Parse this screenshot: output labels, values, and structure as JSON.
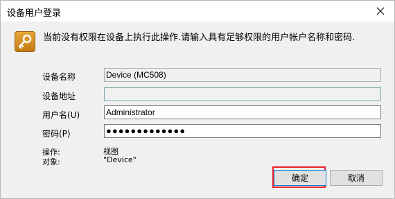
{
  "window": {
    "title": "设备用户登录"
  },
  "message": "当前没有权限在设备上执行此操作.请输入具有足够权限的用户帐户名称和密码.",
  "fields": {
    "device_name": {
      "label": "设备名称",
      "value": "Device (MC508)"
    },
    "device_address": {
      "label": "设备地址",
      "value": ""
    },
    "username": {
      "label": "用户名(U)",
      "value": "Administrator"
    },
    "password": {
      "label": "密码(P)",
      "value": "●●●●●●●●●●●●●"
    }
  },
  "info": {
    "operation_label": "操作:",
    "operation_value": "视图",
    "object_label": "对象:",
    "object_value": "\"Device\""
  },
  "buttons": {
    "ok": "确定",
    "cancel": "取消"
  },
  "colors": {
    "highlight": "#e8232b",
    "accent": "#0078d7"
  },
  "icons": {
    "header": "key-icon",
    "close": "close-icon"
  }
}
